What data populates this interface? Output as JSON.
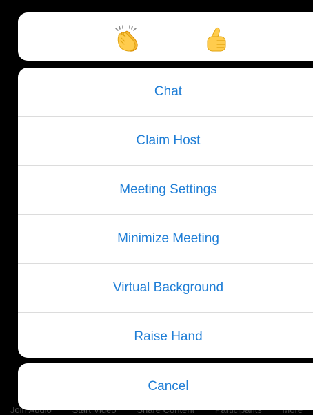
{
  "reactions": [
    {
      "name": "clap",
      "icon": "clapping-hands-icon"
    },
    {
      "name": "thumbs_up",
      "icon": "thumbs-up-icon"
    }
  ],
  "actions": {
    "chat": "Chat",
    "claim_host": "Claim Host",
    "meeting_settings": "Meeting Settings",
    "minimize_meeting": "Minimize Meeting",
    "virtual_background": "Virtual Background",
    "raise_hand": "Raise Hand"
  },
  "cancel_label": "Cancel",
  "background_toolbar": {
    "items": [
      "Join Audio",
      "Start Video",
      "Share Content",
      "Participants",
      "More"
    ]
  },
  "colors": {
    "accent": "#1f7ed6",
    "sheet": "#ffffff",
    "backdrop": "#000000",
    "divider": "#dcdcdc"
  }
}
